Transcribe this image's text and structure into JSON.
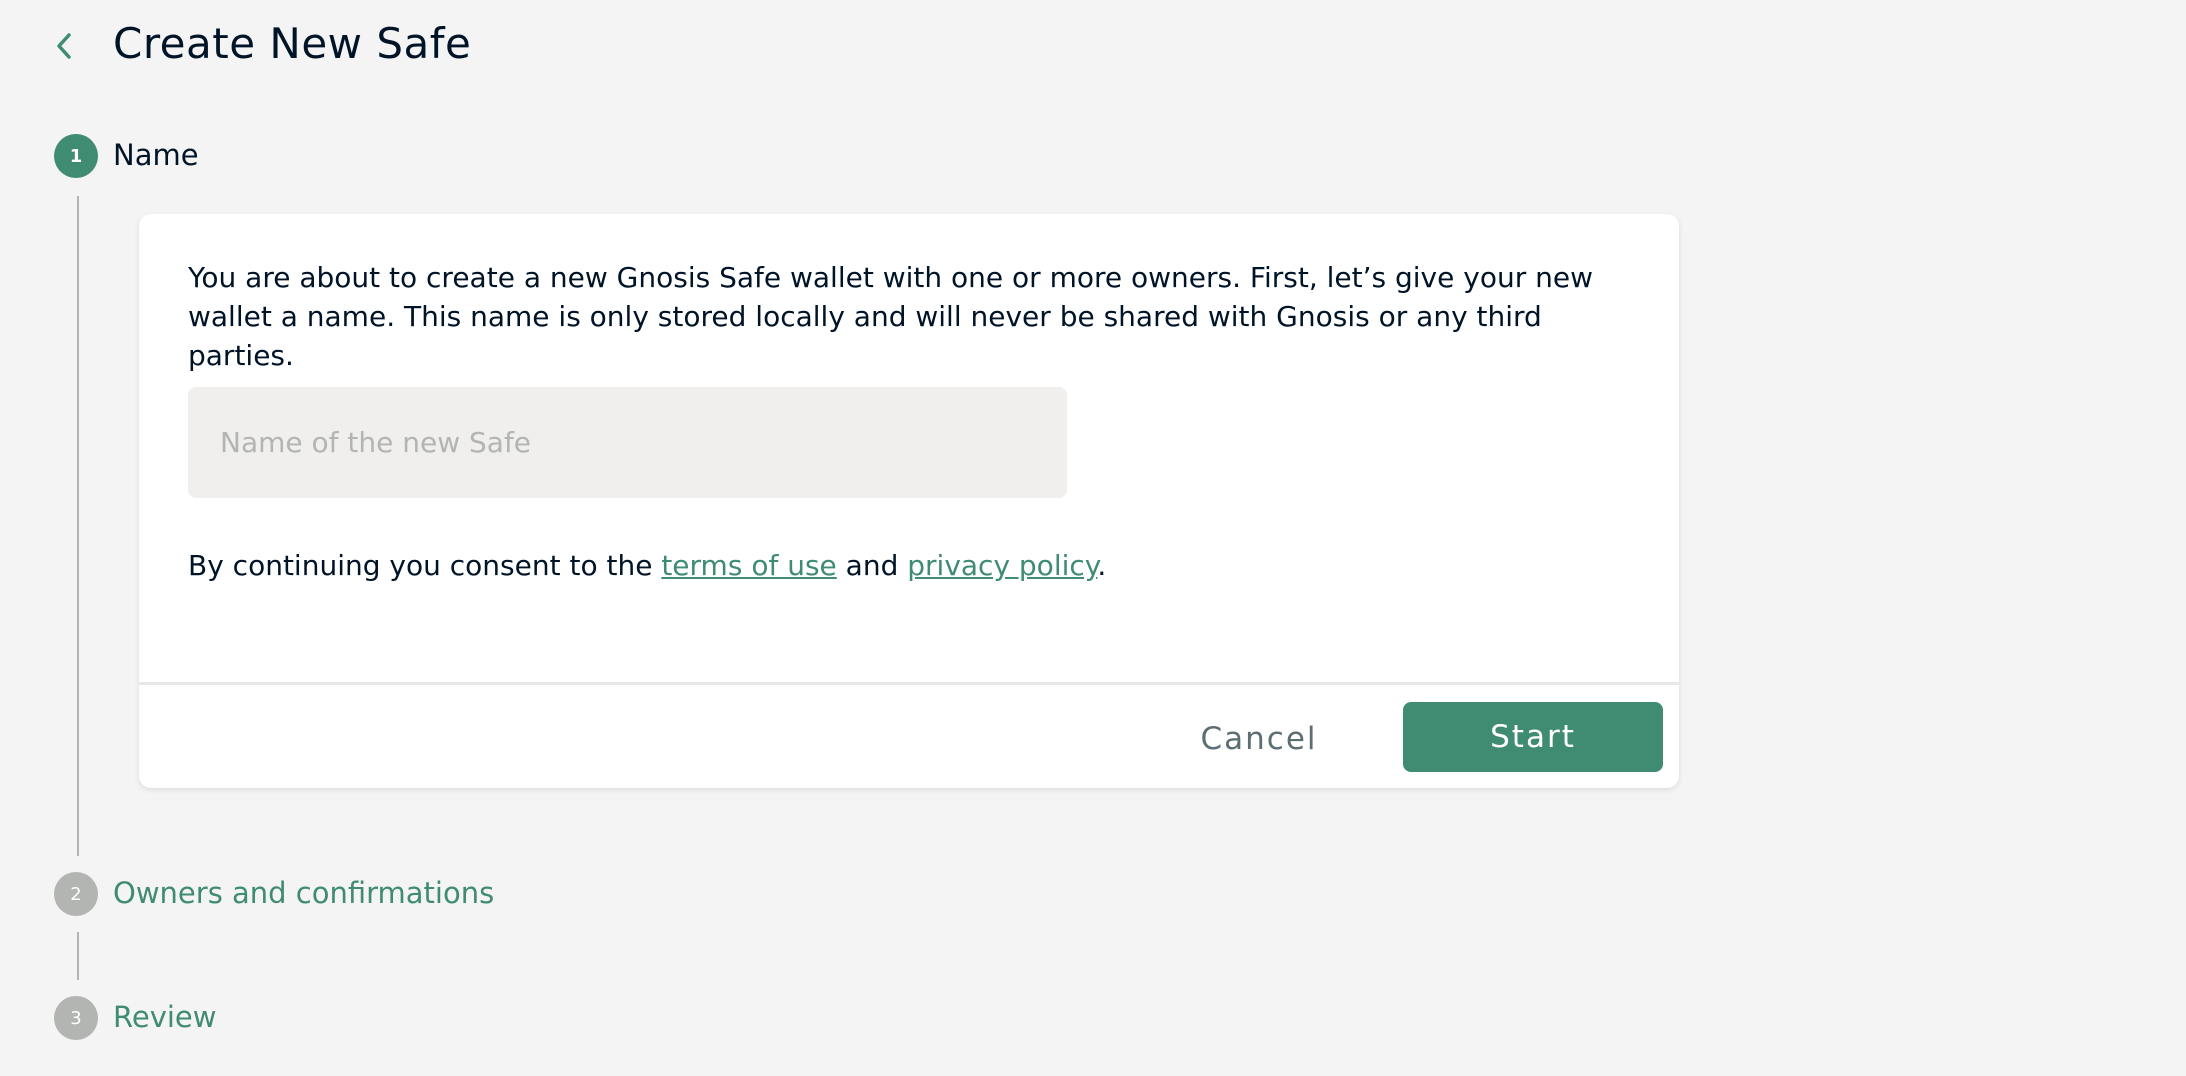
{
  "header": {
    "title": "Create New Safe",
    "back_icon": "chevron-left-icon"
  },
  "colors": {
    "accent": "#3f8c72",
    "inactive_step": "#b2b5b2",
    "text": "#001428",
    "background": "#f5f4f4"
  },
  "steps": [
    {
      "number": "1",
      "label": "Name",
      "state": "active"
    },
    {
      "number": "2",
      "label": "Owners and confirmations",
      "state": "inactive"
    },
    {
      "number": "3",
      "label": "Review",
      "state": "inactive"
    }
  ],
  "card": {
    "description": "You are about to create a new Gnosis Safe wallet with one or more owners. First, let’s give your new wallet a name. This name is only stored locally and will never be shared with Gnosis or any third parties.",
    "input": {
      "placeholder": "Name of the new Safe",
      "value": ""
    },
    "consent": {
      "prefix": "By continuing you consent to the ",
      "terms_link": "terms of use",
      "middle": " and ",
      "privacy_link": "privacy policy",
      "suffix": "."
    },
    "cancel_label": "Cancel",
    "start_label": "Start"
  }
}
